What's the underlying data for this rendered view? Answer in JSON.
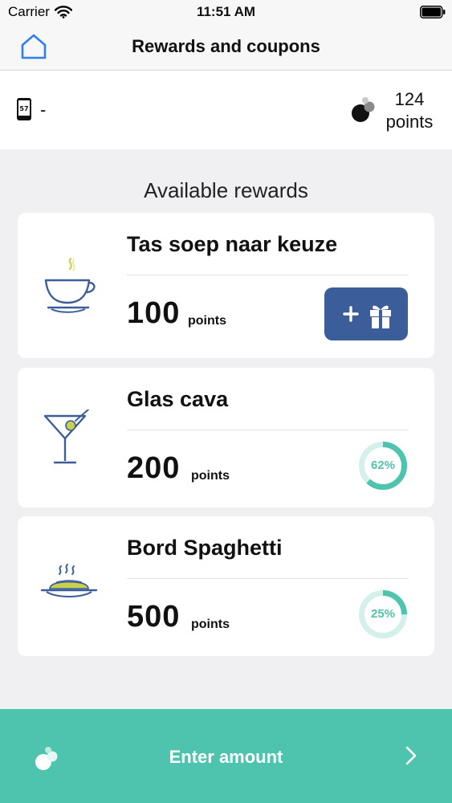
{
  "status": {
    "carrier": "Carrier",
    "time": "11:51 AM"
  },
  "nav": {
    "title": "Rewards and coupons",
    "home_icon": "home-icon"
  },
  "account": {
    "card_value": "-",
    "points_value": "124",
    "points_label": "points"
  },
  "section_title": "Available rewards",
  "rewards": [
    {
      "title": "Tas soep naar keuze",
      "points": "100",
      "unit": "points",
      "icon": "soup-cup-icon",
      "status": "claimable"
    },
    {
      "title": "Glas cava",
      "points": "200",
      "unit": "points",
      "icon": "cocktail-glass-icon",
      "status": "progress",
      "progress_label": "62%",
      "progress": 0.62
    },
    {
      "title": "Bord Spaghetti",
      "points": "500",
      "unit": "points",
      "icon": "spaghetti-plate-icon",
      "status": "progress",
      "progress_label": "25%",
      "progress": 0.25
    }
  ],
  "footer": {
    "label": "Enter amount"
  },
  "colors": {
    "accent": "#4ec4ae",
    "button": "#3b5e9a",
    "illustration": "#3b5e9a",
    "illustration_accent": "#c9d14a"
  }
}
